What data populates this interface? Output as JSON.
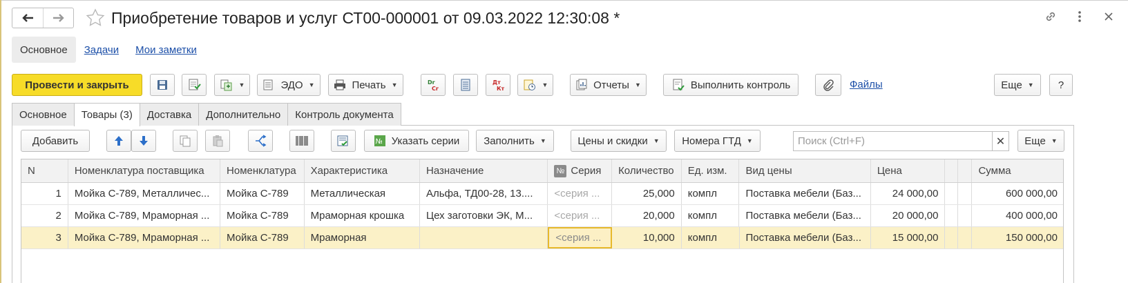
{
  "window": {
    "title": "Приобретение товаров и услуг СТ00-000001 от 09.03.2022 12:30:08 *",
    "icons": [
      "link-icon",
      "more-vert-icon",
      "close-icon"
    ]
  },
  "section_tabs": [
    {
      "label": "Основное",
      "active": true
    },
    {
      "label": "Задачи",
      "active": false
    },
    {
      "label": "Мои заметки",
      "active": false
    }
  ],
  "toolbar": {
    "post_close": "Провести и закрыть",
    "edo": "ЭДО",
    "print": "Печать",
    "reports": "Отчеты",
    "control": "Выполнить контроль",
    "files": "Файлы",
    "more": "Еще",
    "help": "?"
  },
  "content_tabs": [
    {
      "label": "Основное"
    },
    {
      "label": "Товары (3)"
    },
    {
      "label": "Доставка"
    },
    {
      "label": "Дополнительно"
    },
    {
      "label": "Контроль документа"
    }
  ],
  "table_toolbar": {
    "add": "Добавить",
    "set_series": "Указать серии",
    "fill": "Заполнить",
    "prices": "Цены и скидки",
    "gtd": "Номера ГТД",
    "search_placeholder": "Поиск (Ctrl+F)",
    "more": "Еще"
  },
  "table": {
    "columns": [
      "N",
      "Номенклатура поставщика",
      "Номенклатура",
      "Характеристика",
      "Назначение",
      "Серия",
      "Количество",
      "Ед. изм.",
      "Вид цены",
      "Цена",
      "",
      "",
      "Сумма"
    ],
    "serie_mark": "№",
    "rows": [
      {
        "n": "1",
        "supplier_item": "Мойка С-789, Металличес...",
        "item": "Мойка С-789",
        "characteristic": "Металлическая",
        "purpose": "Альфа, ТД00-28, 13....",
        "serie": "<серия ...",
        "qty": "25,000",
        "unit": "компл",
        "price_type": "Поставка мебели (Баз...",
        "price": "24 000,00",
        "sum": "600 000,00"
      },
      {
        "n": "2",
        "supplier_item": "Мойка С-789, Мраморная ...",
        "item": "Мойка С-789",
        "characteristic": "Мраморная крошка",
        "purpose": "Цех заготовки ЭК, М...",
        "serie": "<серия ...",
        "qty": "20,000",
        "unit": "компл",
        "price_type": "Поставка мебели (Баз...",
        "price": "20 000,00",
        "sum": "400 000,00"
      },
      {
        "n": "3",
        "supplier_item": "Мойка С-789, Мраморная ...",
        "item": "Мойка С-789",
        "characteristic": "Мраморная",
        "purpose": "",
        "serie": "<серия ...",
        "qty": "10,000",
        "unit": "компл",
        "price_type": "Поставка мебели (Баз...",
        "price": "15 000,00",
        "sum": "150 000,00"
      }
    ]
  },
  "colors": {
    "primary_button": "#f7dc28",
    "link": "#1c4fa8",
    "selected_row": "#fbf1c7",
    "focus_border": "#e7b92a"
  }
}
